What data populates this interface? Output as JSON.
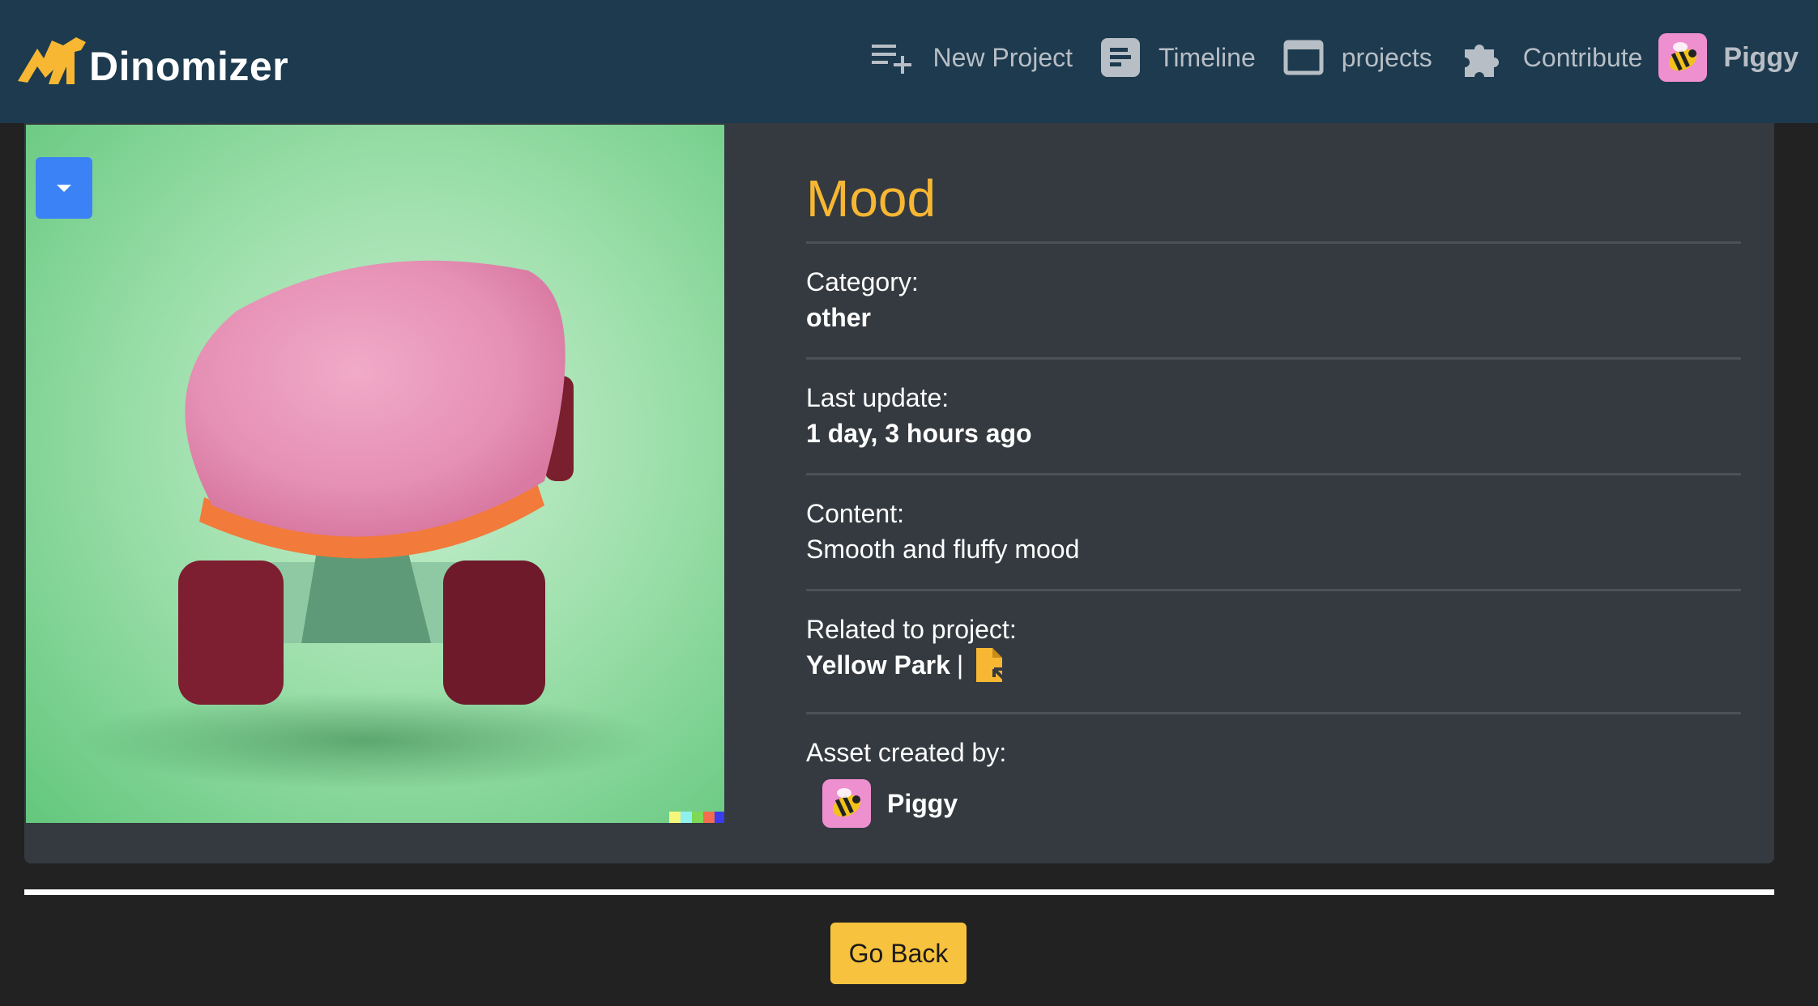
{
  "brand": {
    "name": "Dinomizer",
    "logo": "dino-logo-icon",
    "accent": "#f7b733"
  },
  "nav": {
    "items": [
      {
        "label": "New Project",
        "icon": "playlist-add-icon"
      },
      {
        "label": "Timeline",
        "icon": "timeline-icon"
      },
      {
        "label": "projects",
        "icon": "window-icon"
      },
      {
        "label": "Contribute",
        "icon": "puzzle-icon"
      }
    ],
    "user": {
      "name": "Piggy",
      "avatar": "bee-avatar-icon"
    }
  },
  "asset": {
    "image": "pink-fluffy-skateboard-image",
    "title": "Mood",
    "category_label": "Category:",
    "category": "other",
    "updated_label": "Last update:",
    "updated": "1 day, 3 hours ago",
    "content_label": "Content:",
    "content": "Smooth and fluffy mood",
    "project_label": "Related to project:",
    "project": "Yellow Park",
    "project_separator": "|",
    "project_link_icon": "file-link-icon",
    "creator_label": "Asset created by:",
    "creator": "Piggy"
  },
  "actions": {
    "go_back": "Go Back"
  },
  "colors": {
    "navbar": "#1d3a4e",
    "card": "#343a40",
    "background": "#222222",
    "button": "#f7c23d",
    "dropdown": "#3b82f6"
  }
}
